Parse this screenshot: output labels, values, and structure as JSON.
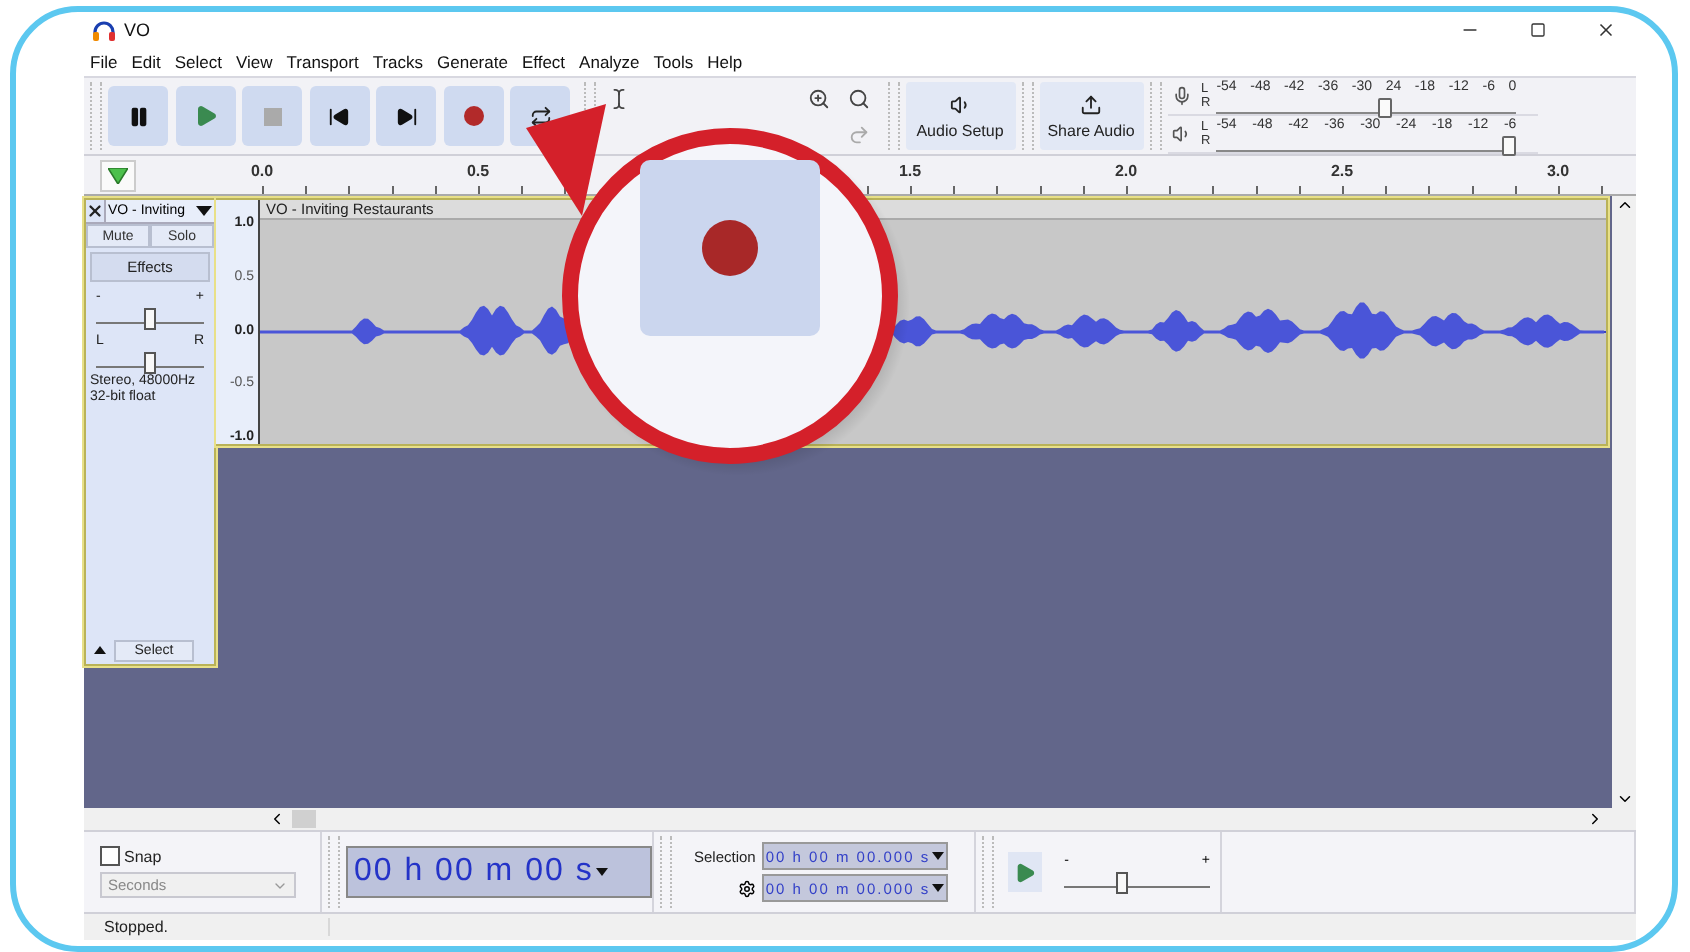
{
  "window": {
    "title": "VO"
  },
  "menu": [
    "File",
    "Edit",
    "Select",
    "View",
    "Transport",
    "Tracks",
    "Generate",
    "Effect",
    "Analyze",
    "Tools",
    "Help"
  ],
  "toolbar": {
    "audio_setup": "Audio Setup",
    "share_audio": "Share Audio"
  },
  "meters": [
    {
      "channels": [
        "L",
        "R"
      ],
      "scale": [
        "-54",
        "-48",
        "-42",
        "-36",
        "-30",
        "24",
        "-18",
        "-12",
        "-6",
        "0"
      ],
      "level": 0.56
    },
    {
      "channels": [
        "L",
        "R"
      ],
      "scale": [
        "-54",
        "-48",
        "-42",
        "-36",
        "-30",
        "-24",
        "-18",
        "-12",
        "-6"
      ],
      "level": 0.97
    }
  ],
  "ruler": [
    "0.0",
    "0.5",
    "1.5",
    "2.0",
    "2.5",
    "3.0"
  ],
  "track": {
    "name": "VO - Inviting",
    "title": "VO - Inviting Restaurants",
    "mute": "Mute",
    "solo": "Solo",
    "effects": "Effects",
    "gain": {
      "minus": "-",
      "plus": "+",
      "level": 0.5
    },
    "pan": {
      "left": "L",
      "right": "R",
      "level": 0.5
    },
    "info": [
      "Stereo, 48000Hz",
      "32-bit float"
    ],
    "select": "Select",
    "scale": [
      "1.0",
      "0.5",
      "0.0",
      "-0.5",
      "-1.0"
    ]
  },
  "bottom": {
    "snap": {
      "label": "Snap",
      "checked": false
    },
    "snap_unit": {
      "value": "Seconds",
      "disabled": true
    },
    "time": "00 h 00 m 00 s",
    "selection": {
      "label": "Selection",
      "start": "00 h 00 m 00.000 s",
      "end": "00 h 00 m 00.000 s"
    },
    "speed": {
      "minus": "-",
      "plus": "+",
      "level": 0.4
    }
  },
  "status_bar": {
    "text": "Stopped."
  }
}
